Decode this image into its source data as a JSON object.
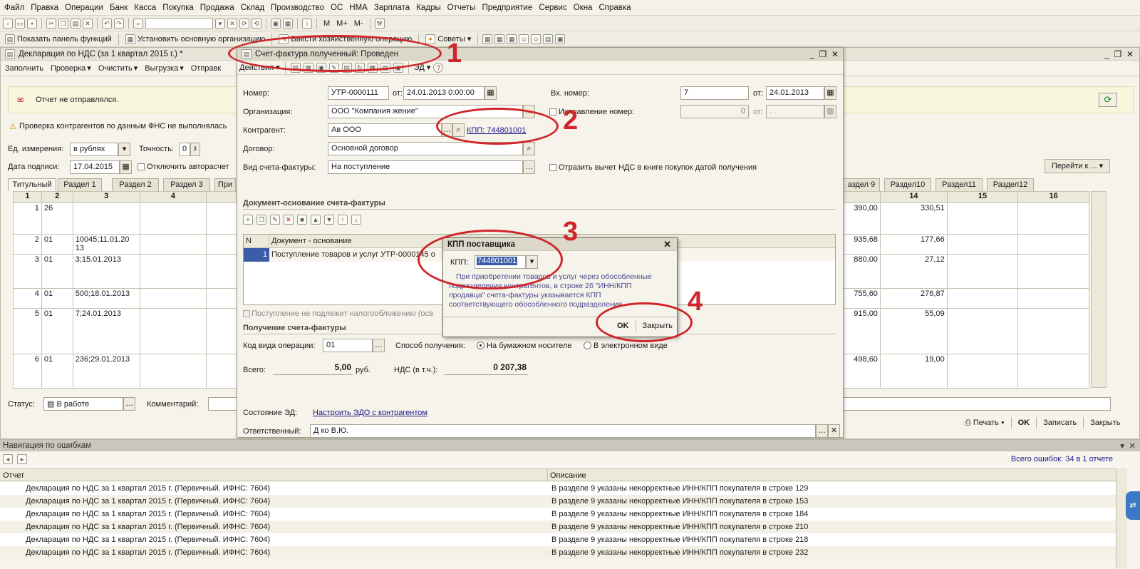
{
  "menu": [
    "Файл",
    "Правка",
    "Операции",
    "Банк",
    "Касса",
    "Покупка",
    "Продажа",
    "Склад",
    "Производство",
    "ОС",
    "НМА",
    "Зарплата",
    "Кадры",
    "Отчеты",
    "Предприятие",
    "Сервис",
    "Окна",
    "Справка"
  ],
  "toolbar2": {
    "show_panel": "Показать панель функций",
    "set_org": "Установить основную организацию",
    "enter_op": "Ввести хозяйственную операцию",
    "tips": "Советы"
  },
  "decl": {
    "title": "Декларация по НДС (за 1 квартал 2015 г.) *",
    "tools": [
      "Заполнить",
      "Проверка",
      "Очистить",
      "Выгрузка",
      "Отправк"
    ],
    "status_msg": "Отчет не отправлялся.",
    "warning": "Проверка контрагентов по данным ФНС не выполнялась",
    "unit_label": "Ед. измерения:",
    "unit_value": "в рублях",
    "precision_label": "Точность:",
    "precision_value": "0",
    "sign_date_label": "Дата подписи:",
    "sign_date_value": "17.04.2015",
    "autocalc_label": "Отключить авторасчет",
    "goto_label": "Перейти к ...",
    "tabs_left": [
      "Титульный",
      "Раздел 1",
      "Раздел 2",
      "Раздел 3",
      "При"
    ],
    "tabs_right": [
      "аздел 9",
      "Раздел10",
      "Раздел11",
      "Раздел12"
    ],
    "col_headers_left": [
      "1",
      "2",
      "3",
      "4"
    ],
    "col_headers_right": [
      "14",
      "15",
      "16"
    ],
    "rows": [
      {
        "c1": "1",
        "c2": "26",
        "c3": "",
        "v13": "390,00",
        "v14": "330,51"
      },
      {
        "c1": "2",
        "c2": "01",
        "c3": "10045;11.01.20 13",
        "v13": "935,68",
        "v14": "177,66"
      },
      {
        "c1": "3",
        "c2": "01",
        "c3": "3;15.01.2013",
        "v13": "880,00",
        "v14": "27,12"
      },
      {
        "c1": "4",
        "c2": "01",
        "c3": "500;18.01.2013",
        "v13": "755,60",
        "v14": "276,87"
      },
      {
        "c1": "5",
        "c2": "01",
        "c3": "7;24.01.2013",
        "v13": "915,00",
        "v14": "55,09"
      },
      {
        "c1": "6",
        "c2": "01",
        "c3": "236;29.01.2013",
        "v13": "498,60",
        "v14": "19,00"
      }
    ],
    "status_label": "Статус:",
    "status_value": "В работе",
    "comment_label": "Комментарий:",
    "print": "Печать",
    "ok": "OK",
    "save": "Записать",
    "close": "Закрыть"
  },
  "invoice": {
    "title": "Счет-фактура полученный: Проведен",
    "actions": "Действия",
    "ed": "ЭД",
    "number_label": "Номер:",
    "number_value": "УТР-0000111",
    "from_label": "от:",
    "date_value": "24.01.2013 0:00:00",
    "in_number_label": "Вх. номер:",
    "in_number_value": "7",
    "in_date_value": "24.01.2013",
    "org_label": "Организация:",
    "org_value": "ООО \"Компания                        жение\"",
    "correction_label": "Исправление номер:",
    "correction_value": "0",
    "correction_date": ". .",
    "counterparty_label": "Контрагент:",
    "counterparty_value": "Ав                    ООО",
    "kpp_link": "КПП: 744801001",
    "contract_label": "Договор:",
    "contract_value": "Основной договор",
    "kind_label": "Вид счета-фактуры:",
    "kind_value": "На поступление",
    "deduct_label": "Отразить вычет НДС в книге покупок датой получения",
    "basis_section": "Документ-основание счета-фактуры",
    "basis_headers": [
      "N",
      "Документ - основание"
    ],
    "basis_rows": [
      {
        "n": "1",
        "doc": "Поступление товаров и услуг УТР-0000145 о"
      }
    ],
    "not_taxed_label": "Поступление не подлежит налогообложению (осв",
    "receipt_section": "Получение счета-фактуры",
    "op_code_label": "Код вида операции:",
    "op_code_value": "01",
    "method_label": "Способ получения:",
    "paper_label": "На бумажном носителе",
    "electronic_label": "В электронном виде",
    "total_label": "Всего:",
    "total_value": "5,00",
    "currency": "руб.",
    "vat_label": "НДС (в т.ч.):",
    "vat_value": "0 207,38",
    "ed_state_label": "Состояние ЭД:",
    "edo_link": "Настроить ЭДО с контрагентом",
    "resp_label": "Ответственный:",
    "resp_value": "Д                  ко В.Ю."
  },
  "kpp_dialog": {
    "title": "КПП поставщика",
    "kpp_label": "КПП:",
    "kpp_value": "744801001",
    "info": "При приобретении товаров и услуг через обособленные подразделения контрагентов, в строке 2б \"ИНН/КПП продавца\" счета-фактуры указывается КПП соответствующего обособленного подразделения.",
    "ok": "OK",
    "close": "Закрыть"
  },
  "errors": {
    "title": "Навигация по ошибкам",
    "summary": "Всего ошибок: 34 в 1 отчете",
    "col_report": "Отчет",
    "col_desc": "Описание",
    "rows": [
      {
        "report": "Декларация по НДС за 1 квартал 2015 г. (Первичный. ИФНС: 7604)",
        "desc": "В разделе 9 указаны некорректные ИНН/КПП покупателя в строке 129"
      },
      {
        "report": "Декларация по НДС за 1 квартал 2015 г. (Первичный. ИФНС: 7604)",
        "desc": "В разделе 9 указаны некорректные ИНН/КПП покупателя в строке 153"
      },
      {
        "report": "Декларация по НДС за 1 квартал 2015 г. (Первичный. ИФНС: 7604)",
        "desc": "В разделе 9 указаны некорректные ИНН/КПП покупателя в строке 184"
      },
      {
        "report": "Декларация по НДС за 1 квартал 2015 г. (Первичный. ИФНС: 7604)",
        "desc": "В разделе 9 указаны некорректные ИНН/КПП покупателя в строке 210"
      },
      {
        "report": "Декларация по НДС за 1 квартал 2015 г. (Первичный. ИФНС: 7604)",
        "desc": "В разделе 9 указаны некорректные ИНН/КПП покупателя в строке 218"
      },
      {
        "report": "Декларация по НДС за 1 квартал 2015 г. (Первичный. ИФНС: 7604)",
        "desc": "В разделе 9 указаны некорректные ИНН/КПП покупателя в строке 232"
      }
    ]
  },
  "annotations": [
    "1",
    "2",
    "3",
    "4"
  ],
  "colors": {
    "annotation": "#d0252a",
    "link": "#1a1a8a",
    "selection": "#3b5da8"
  }
}
